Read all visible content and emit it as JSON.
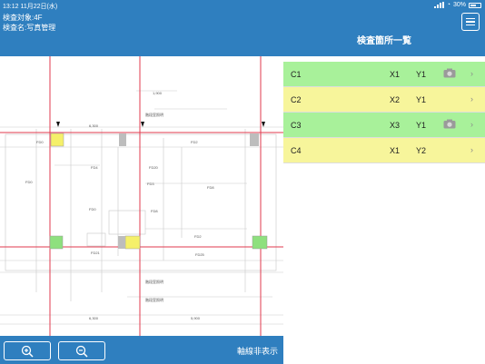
{
  "status": {
    "time": "13:12",
    "date": "11月22日(水)",
    "battery": "30%"
  },
  "header": {
    "subject_line": "検査対象:4F",
    "name_line": "検査名:写真管理",
    "panel_title": "検査箇所一覧"
  },
  "drawing": {
    "rooms": [
      "FD0",
      "FD0",
      "FD4",
      "FD2",
      "FD20",
      "FD3",
      "FD0",
      "FD8",
      "FD25",
      "FD21",
      "FD2",
      "FD8"
    ],
    "dimensions": [
      "1,900",
      "6,300",
      "5,900",
      "6,300"
    ],
    "labels": [
      "階段室照明",
      "階段室照明",
      "階段室照明"
    ],
    "colors": {
      "grid_line": "#e03a4e",
      "marker_green": "#8ee07e",
      "marker_yellow": "#f5f06a",
      "marker_gray": "#bdbdbd"
    }
  },
  "toolbar": {
    "zoom_in_icon": "zoom-in-icon",
    "zoom_out_icon": "zoom-out-icon",
    "axis_toggle_label": "軸線非表示"
  },
  "inspection_points": [
    {
      "code": "C1",
      "x": "X1",
      "y": "Y1",
      "photo": true,
      "color": "#a8f19a"
    },
    {
      "code": "C2",
      "x": "X2",
      "y": "Y1",
      "photo": false,
      "color": "#f7f59b"
    },
    {
      "code": "C3",
      "x": "X3",
      "y": "Y1",
      "photo": true,
      "color": "#a8f19a"
    },
    {
      "code": "C4",
      "x": "X1",
      "y": "Y2",
      "photo": false,
      "color": "#f7f59b"
    }
  ]
}
